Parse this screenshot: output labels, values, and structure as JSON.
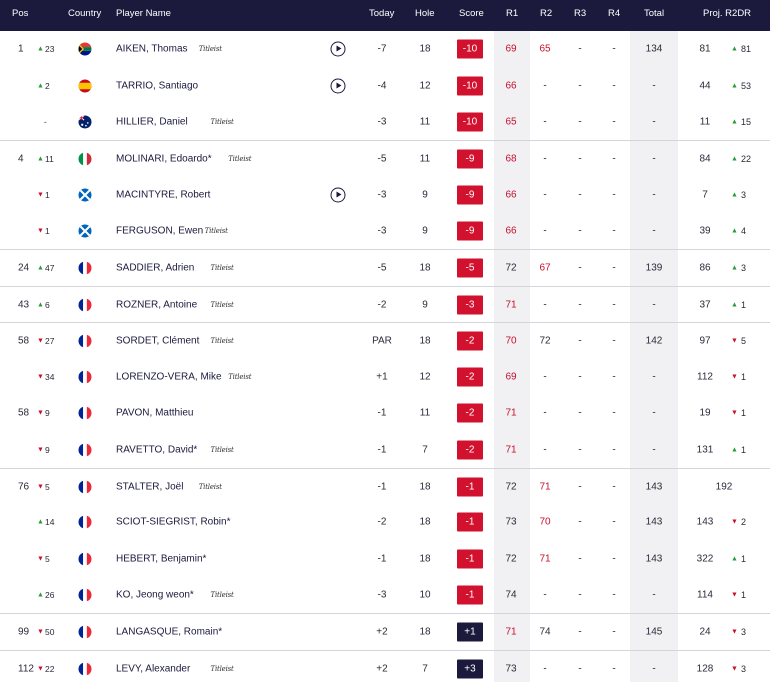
{
  "header": {
    "pos": "Pos",
    "country": "Country",
    "player": "Player Name",
    "today": "Today",
    "hole": "Hole",
    "score": "Score",
    "r1": "R1",
    "r2": "R2",
    "r3": "R3",
    "r4": "R4",
    "total": "Total",
    "proj": "Proj. R2DR"
  },
  "brand_logo_text": "Titleist",
  "colors": {
    "header_bg": "#1b1a3d",
    "under_par": "#d1112d",
    "over_par": "#1b1a3d",
    "up": "#2a9a3a",
    "down": "#c8102e"
  },
  "rows": [
    {
      "pos": "1",
      "move": "23",
      "dir": "up",
      "flag": "za",
      "name": "AIKEN, Thomas",
      "logo": true,
      "video": true,
      "today": "-7",
      "hole": "18",
      "score": "-10",
      "r1": "69",
      "r2": "65",
      "r3": "-",
      "r4": "-",
      "total": "134",
      "proj": "81",
      "pdir": "up",
      "pmove": "81",
      "sep": false
    },
    {
      "pos": "",
      "move": "2",
      "dir": "up",
      "flag": "es",
      "name": "TARRIO, Santiago",
      "logo": false,
      "video": true,
      "today": "-4",
      "hole": "12",
      "score": "-10",
      "r1": "66",
      "r2": "-",
      "r3": "-",
      "r4": "-",
      "total": "-",
      "proj": "44",
      "pdir": "up",
      "pmove": "53",
      "sep": false
    },
    {
      "pos": "",
      "move": "-",
      "dir": "none",
      "flag": "au",
      "name": "HILLIER, Daniel",
      "logo": true,
      "video": false,
      "today": "-3",
      "hole": "11",
      "score": "-10",
      "r1": "65",
      "r2": "-",
      "r3": "-",
      "r4": "-",
      "total": "-",
      "proj": "11",
      "pdir": "up",
      "pmove": "15",
      "sep": false
    },
    {
      "pos": "4",
      "move": "11",
      "dir": "up",
      "flag": "it",
      "name": "MOLINARI, Edoardo*",
      "logo": true,
      "video": false,
      "today": "-5",
      "hole": "11",
      "score": "-9",
      "r1": "68",
      "r2": "-",
      "r3": "-",
      "r4": "-",
      "total": "-",
      "proj": "84",
      "pdir": "up",
      "pmove": "22",
      "sep": true
    },
    {
      "pos": "",
      "move": "1",
      "dir": "down",
      "flag": "sc",
      "name": "MACINTYRE, Robert",
      "logo": false,
      "video": true,
      "today": "-3",
      "hole": "9",
      "score": "-9",
      "r1": "66",
      "r2": "-",
      "r3": "-",
      "r4": "-",
      "total": "-",
      "proj": "7",
      "pdir": "up",
      "pmove": "3",
      "sep": false
    },
    {
      "pos": "",
      "move": "1",
      "dir": "down",
      "flag": "sc",
      "name": "FERGUSON, Ewen",
      "logo": true,
      "video": false,
      "today": "-3",
      "hole": "9",
      "score": "-9",
      "r1": "66",
      "r2": "-",
      "r3": "-",
      "r4": "-",
      "total": "-",
      "proj": "39",
      "pdir": "up",
      "pmove": "4",
      "sep": false
    },
    {
      "pos": "24",
      "move": "47",
      "dir": "up",
      "flag": "fr",
      "name": "SADDIER, Adrien",
      "logo": true,
      "video": false,
      "today": "-5",
      "hole": "18",
      "score": "-5",
      "r1": "72",
      "r2": "67",
      "r3": "-",
      "r4": "-",
      "total": "139",
      "proj": "86",
      "pdir": "up",
      "pmove": "3",
      "sep": true
    },
    {
      "pos": "43",
      "move": "6",
      "dir": "up",
      "flag": "fr",
      "name": "ROZNER, Antoine",
      "logo": true,
      "video": false,
      "today": "-2",
      "hole": "9",
      "score": "-3",
      "r1": "71",
      "r2": "-",
      "r3": "-",
      "r4": "-",
      "total": "-",
      "proj": "37",
      "pdir": "up",
      "pmove": "1",
      "sep": true
    },
    {
      "pos": "58",
      "move": "27",
      "dir": "down",
      "flag": "fr",
      "name": "SORDET, Clément",
      "logo": true,
      "video": false,
      "today": "PAR",
      "hole": "18",
      "score": "-2",
      "r1": "70",
      "r2": "72",
      "r3": "-",
      "r4": "-",
      "total": "142",
      "proj": "97",
      "pdir": "down",
      "pmove": "5",
      "sep": true
    },
    {
      "pos": "",
      "move": "34",
      "dir": "down",
      "flag": "fr",
      "name": "LORENZO-VERA, Mike",
      "logo": true,
      "video": false,
      "today": "+1",
      "hole": "12",
      "score": "-2",
      "r1": "69",
      "r2": "-",
      "r3": "-",
      "r4": "-",
      "total": "-",
      "proj": "112",
      "pdir": "down",
      "pmove": "1",
      "sep": false
    },
    {
      "pos": "58",
      "move": "9",
      "dir": "down",
      "flag": "fr",
      "name": "PAVON, Matthieu",
      "logo": false,
      "video": false,
      "today": "-1",
      "hole": "11",
      "score": "-2",
      "r1": "71",
      "r2": "-",
      "r3": "-",
      "r4": "-",
      "total": "-",
      "proj": "19",
      "pdir": "down",
      "pmove": "1",
      "sep": false
    },
    {
      "pos": "",
      "move": "9",
      "dir": "down",
      "flag": "fr",
      "name": "RAVETTO, David*",
      "logo": true,
      "video": false,
      "today": "-1",
      "hole": "7",
      "score": "-2",
      "r1": "71",
      "r2": "-",
      "r3": "-",
      "r4": "-",
      "total": "-",
      "proj": "131",
      "pdir": "up",
      "pmove": "1",
      "sep": false
    },
    {
      "pos": "76",
      "move": "5",
      "dir": "down",
      "flag": "fr",
      "name": "STALTER, Joël",
      "logo": true,
      "video": false,
      "today": "-1",
      "hole": "18",
      "score": "-1",
      "r1": "72",
      "r2": "71",
      "r3": "-",
      "r4": "-",
      "total": "143",
      "proj": "192",
      "pdir": "none",
      "pmove": "",
      "sep": true
    },
    {
      "pos": "",
      "move": "14",
      "dir": "up",
      "flag": "fr",
      "name": "SCIOT-SIEGRIST, Robin*",
      "logo": false,
      "video": false,
      "today": "-2",
      "hole": "18",
      "score": "-1",
      "r1": "73",
      "r2": "70",
      "r3": "-",
      "r4": "-",
      "total": "143",
      "proj": "143",
      "pdir": "down",
      "pmove": "2",
      "sep": false
    },
    {
      "pos": "",
      "move": "5",
      "dir": "down",
      "flag": "fr",
      "name": "HEBERT, Benjamin*",
      "logo": false,
      "video": false,
      "today": "-1",
      "hole": "18",
      "score": "-1",
      "r1": "72",
      "r2": "71",
      "r3": "-",
      "r4": "-",
      "total": "143",
      "proj": "322",
      "pdir": "up",
      "pmove": "1",
      "sep": false
    },
    {
      "pos": "",
      "move": "26",
      "dir": "up",
      "flag": "fr",
      "name": "KO, Jeong weon*",
      "logo": true,
      "video": false,
      "today": "-3",
      "hole": "10",
      "score": "-1",
      "r1": "74",
      "r2": "-",
      "r3": "-",
      "r4": "-",
      "total": "-",
      "proj": "114",
      "pdir": "down",
      "pmove": "1",
      "sep": false
    },
    {
      "pos": "99",
      "move": "50",
      "dir": "down",
      "flag": "fr",
      "name": "LANGASQUE, Romain*",
      "logo": false,
      "video": false,
      "today": "+2",
      "hole": "18",
      "score": "+1",
      "r1": "71",
      "r2": "74",
      "r3": "-",
      "r4": "-",
      "total": "145",
      "proj": "24",
      "pdir": "down",
      "pmove": "3",
      "sep": true
    },
    {
      "pos": "112",
      "move": "22",
      "dir": "down",
      "flag": "fr",
      "name": "LEVY, Alexander",
      "logo": true,
      "video": false,
      "today": "+2",
      "hole": "7",
      "score": "+3",
      "r1": "73",
      "r2": "-",
      "r3": "-",
      "r4": "-",
      "total": "-",
      "proj": "128",
      "pdir": "down",
      "pmove": "3",
      "sep": true
    }
  ]
}
